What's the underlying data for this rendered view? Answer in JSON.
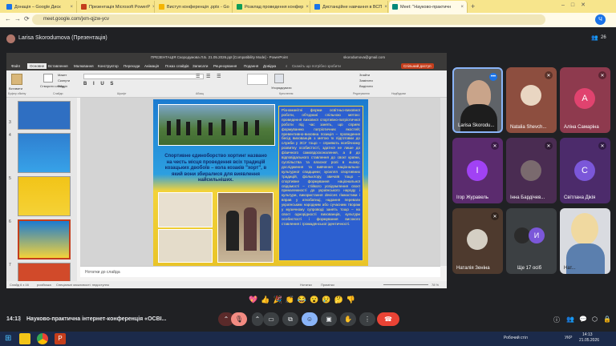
{
  "browser": {
    "tabs": [
      {
        "label": "Донація – Google Диск",
        "color": "#1a73e8"
      },
      {
        "label": "Презентація Microsoft PowerP",
        "color": "#c43e1c"
      },
      {
        "label": "Виступ конференція .pptx - Go",
        "color": "#f4b400"
      },
      {
        "label": "Розклад проведення конфер",
        "color": "#0f9d58"
      },
      {
        "label": "Дистанційне навчання в ВСП",
        "color": "#1a73e8"
      },
      {
        "label": "Meet: \"Науково-практичн",
        "color": "#00897b"
      }
    ],
    "url": "meet.google.com/jxm-qjzw-ycv"
  },
  "meet": {
    "presenter": "Larisa Skorodumova (Презентація)",
    "participant_count": "26",
    "meeting_time": "14:13",
    "meeting_title": "Науково-практична інтернет-конференція «ОСВІ...",
    "reactions": [
      "💖",
      "👍",
      "🎉",
      "👏",
      "😂",
      "😮",
      "😢",
      "🤔",
      "👎"
    ]
  },
  "ppt": {
    "title": "ПРЕЗЕНТАЦІЯ Скородумова Л.Б. 21.05.2026.ppt [Compatibility Mode] - PowerPoint",
    "account": "skorodumova@gmail.com",
    "menu": [
      "Файл",
      "Основне",
      "Вставлення",
      "Малювання",
      "Конструктор",
      "Переходи",
      "Анімація",
      "Показ слайдів",
      "Записати",
      "Рецензування",
      "Подання",
      "Довідка"
    ],
    "search_placeholder": "Скажіть що потрібно зробити",
    "share_label": "Спільний доступ",
    "ribbon_groups": [
      "Буфер обміну",
      "Слайди",
      "Шрифт",
      "Абзац",
      "Креслення",
      "Редагування",
      "Надбудови"
    ],
    "ribbon_buttons": {
      "paste": "Вставити",
      "new_slide": "Створити слайд",
      "layout": "Макет",
      "reset": "Скинути",
      "section": "Розділ",
      "arrange": "Упорядкувати",
      "find": "Знайти",
      "replace": "Замінити",
      "select": "Виділити"
    },
    "thumb_numbers": [
      "3",
      "4",
      "5",
      "6",
      "7"
    ],
    "notes_placeholder": "Нотатки до слайда",
    "status_left": "Слайд 6 з 16",
    "status_lang": "російська",
    "status_access": "Спеціальні можливості: недоступно",
    "status_notes": "Нотатки",
    "status_comments": "Примітки",
    "zoom": "78 %"
  },
  "slide": {
    "caption": "Спортивне єдиноборство хортинг названо на честь місця проведення всіх традицій козацьких двобоїв – кола козаків \"хорт\", в який вони збиралися для виявлення найсильніших.",
    "body": "Різноманітні форми освітньо-виховної роботи, об'єднані спільною метою: проведення виховної спортивно-патріотичної роботи під час занять, що сприяє формуванню патріотичних якостей; превентивно-виховна позиція – проведення бесід вихованців з метою їх підготовки до служби у ЗСУ тощо – сприяють всебічному розвитку особистості, здатної не лише до фізичного самовдосконалення, а й до відповідального ставлення до своєї країни, суспільства та власної ролі в ньому; дослідження та вивчення національно-культурної спадщини; зусилля спортивних традицій, фольклору, звичаїв тощо – спортивне формування національної свідомості – стійкого усвідомлення своєї приналежності до українського народу і культури, використання devices гімнастики і вправ у аткобатиці, надання переваги українським народним або сучасним творам у музичному супроводі занять тощо – на своєї однорідності вихованців, культури особистості і формування високого ставлення і громадянської ідентичності."
  },
  "participants": [
    {
      "name": "Larisa Skorodu...",
      "bg": "#5f6368",
      "type": "video"
    },
    {
      "name": "Natalia Shevch...",
      "bg": "#8d4e3f",
      "type": "photo"
    },
    {
      "name": "Аліна Самаріна",
      "bg": "#8e3a4e",
      "initial": "А",
      "avatar_bg": "#e0436f"
    },
    {
      "name": "Ігор Журавель",
      "bg": "#5b2b6e",
      "initial": "І",
      "avatar_bg": "#a142f4"
    },
    {
      "name": "Інна Бардічев...",
      "bg": "#4a2c52",
      "type": "photo"
    },
    {
      "name": "Світлана Дікія",
      "bg": "#4c2b6b",
      "initial": "С",
      "avatar_bg": "#7b57d9"
    },
    {
      "name": "Наталія Зеніна",
      "bg": "#4e3a2e",
      "type": "photo"
    },
    {
      "name": "Ще 17 осіб",
      "bg": "#3c4043",
      "initial": "И",
      "avatar_bg": "#7b57d9"
    },
    {
      "name": "Нат...",
      "bg": "#6b5f52",
      "type": "video"
    }
  ],
  "taskbar": {
    "desktop": "Робочий стіл",
    "lang": "УКР",
    "time": "14:13",
    "date": "21.05.2026"
  }
}
